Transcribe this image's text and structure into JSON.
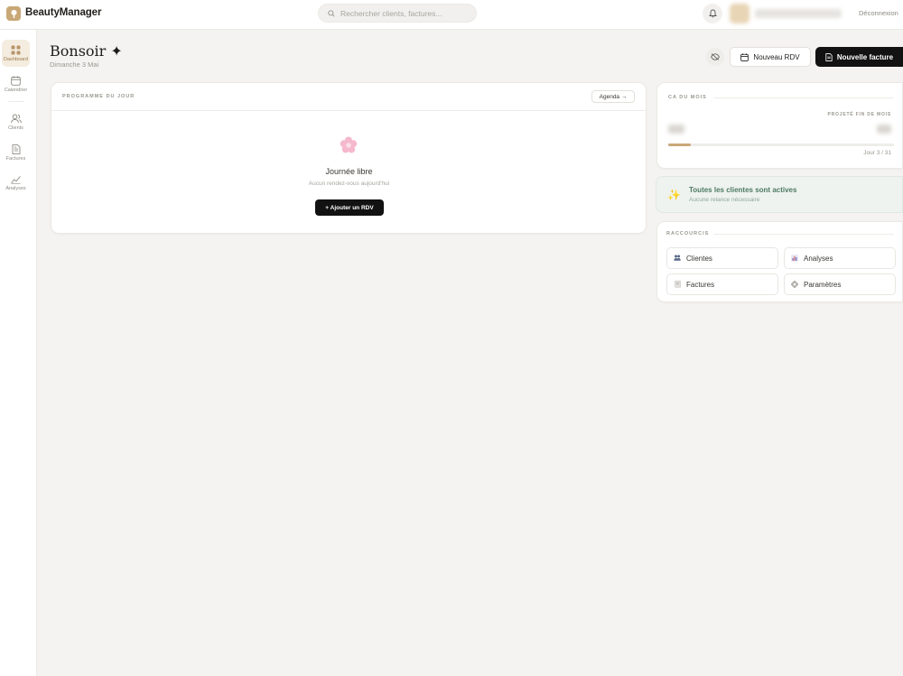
{
  "app": {
    "title": "BeautyManager"
  },
  "topbar": {
    "search_placeholder": "Rechercher clients, factures...",
    "logout_label": "Déconnexion"
  },
  "sidebar": {
    "items": [
      {
        "label": "Dashboard",
        "icon": "grid-icon",
        "active": true
      },
      {
        "label": "Calendrier",
        "icon": "calendar-icon",
        "active": false
      },
      {
        "label": "Clients",
        "icon": "users-icon",
        "active": false
      },
      {
        "label": "Factures",
        "icon": "document-icon",
        "active": false
      },
      {
        "label": "Analyses",
        "icon": "chart-line-icon",
        "active": false
      }
    ]
  },
  "header": {
    "greeting": "Bonsoir ✦",
    "date": "Dimanche 3 Mai",
    "new_rdv_label": "Nouveau RDV",
    "new_invoice_label": "Nouvelle facture"
  },
  "programme": {
    "title": "PROGRAMME DU JOUR",
    "agenda_label": "Agenda →",
    "empty_title": "Journée libre",
    "empty_subtitle": "Aucun rendez-vous aujourd'hui",
    "add_rdv_label": "+ Ajouter un RDV"
  },
  "ca": {
    "title": "CA DU MOIS",
    "projection_label": "PROJETÉ FIN DE MOIS",
    "month_progress": 0.1,
    "day_count": "Jour 3 / 31"
  },
  "alert": {
    "title": "Toutes les clientes sont actives",
    "subtitle": "Aucune relance nécessaire"
  },
  "shortcuts": {
    "title": "RACCOURCIS",
    "items": [
      {
        "label": "Clientes",
        "icon": "people-icon"
      },
      {
        "label": "Analyses",
        "icon": "bar-chart-icon"
      },
      {
        "label": "Factures",
        "icon": "receipt-icon"
      },
      {
        "label": "Paramètres",
        "icon": "settings-icon"
      }
    ]
  },
  "colors": {
    "accent": "#c9a877",
    "primary_button": "#121212",
    "success_bg": "#eef3ef",
    "success_text": "#4e7a63"
  }
}
